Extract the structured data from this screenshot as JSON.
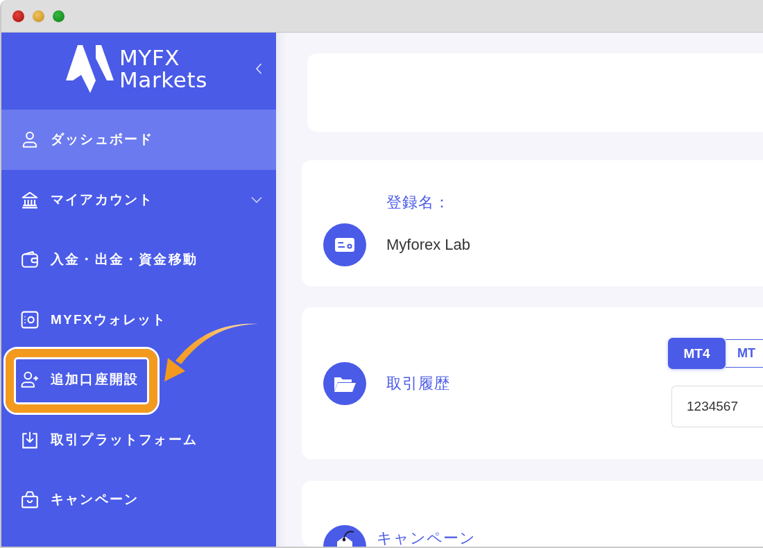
{
  "sidebar": {
    "logo": {
      "text": "MYFX Markets"
    },
    "items": [
      {
        "label": "ダッシュボード",
        "kind": "link",
        "selected": true,
        "highlighted": false
      },
      {
        "label": "マイアカウント",
        "kind": "menu",
        "selected": false,
        "highlighted": false
      },
      {
        "label": "入金・出金・資金移動",
        "kind": "link",
        "selected": false,
        "highlighted": false
      },
      {
        "label": "MYFXウォレット",
        "kind": "link",
        "selected": false,
        "highlighted": false
      },
      {
        "label": "追加口座開設",
        "kind": "link",
        "selected": false,
        "highlighted": true
      },
      {
        "label": "取引プラットフォーム",
        "kind": "link",
        "selected": false,
        "highlighted": false
      },
      {
        "label": "キャンペーン",
        "kind": "link",
        "selected": false,
        "highlighted": false
      }
    ]
  },
  "profile": {
    "label": "登録名：",
    "value": "Myforex Lab"
  },
  "trade_history": {
    "title": "取引履歴",
    "platform_tabs": [
      {
        "label": "MT4",
        "selected": true
      },
      {
        "label": "MT",
        "selected": false
      }
    ],
    "account_field": {
      "value": "1234567"
    }
  },
  "campaign": {
    "title": "キャンペーン"
  }
}
